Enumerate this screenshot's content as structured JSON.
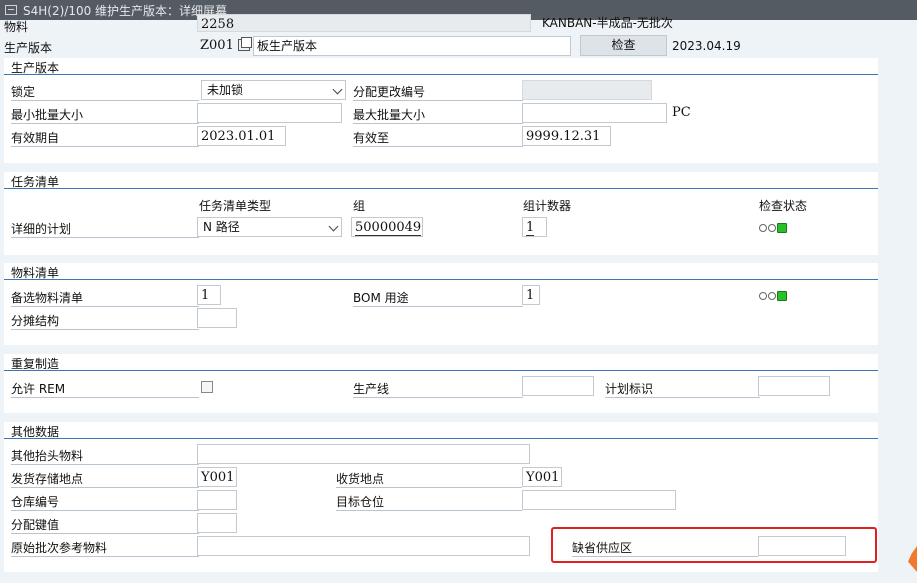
{
  "window": {
    "title": "S4H(2)/100 维护生产版本：详细屏幕"
  },
  "header": {
    "material_label": "物料",
    "material_value": "2258",
    "material_desc": "KANBAN-半成品-无批次",
    "version_label": "生产版本",
    "version_value": "Z001",
    "version_desc": "板生产版本",
    "check_button": "检查",
    "date": "2023.04.19"
  },
  "sec_version": {
    "title": "生产版本",
    "lock_label": "锁定",
    "lock_value": "未加锁",
    "change_no_label": "分配更改编号",
    "min_lot_label": "最小批量大小",
    "max_lot_label": "最大批量大小",
    "unit": "PC",
    "valid_from_label": "有效期自",
    "valid_from_value": "2023.01.01",
    "valid_to_label": "有效至",
    "valid_to_value": "9999.12.31"
  },
  "sec_tasklist": {
    "title": "任务清单",
    "col_type": "任务清单类型",
    "col_group": "组",
    "col_counter": "组计数器",
    "col_status": "检查状态",
    "row_label": "详细的计划",
    "type_value": "N 路径",
    "group_value": "50000049",
    "counter_value": "1"
  },
  "sec_bom": {
    "title": "物料清单",
    "alt_bom_label": "备选物料清单",
    "alt_bom_value": "1",
    "bom_usage_label": "BOM 用途",
    "bom_usage_value": "1",
    "apportion_label": "分摊结构"
  },
  "sec_rem": {
    "title": "重复制造",
    "allow_rem_label": "允许 REM",
    "line_label": "生产线",
    "plan_id_label": "计划标识"
  },
  "sec_other": {
    "title": "其他数据",
    "other_header_label": "其他抬头物料",
    "issue_sloc_label": "发货存储地点",
    "issue_sloc_value": "Y001",
    "receipt_label": "收货地点",
    "receipt_value": "Y001",
    "warehouse_label": "仓库编号",
    "dest_bin_label": "目标仓位",
    "dist_key_label": "分配键值",
    "orig_batch_label": "原始批次参考物料",
    "default_supply_label": "缺省供应区"
  },
  "colors": {
    "accent": "#3a76b8",
    "highlight": "#e02020",
    "status_green": "#28c028"
  }
}
